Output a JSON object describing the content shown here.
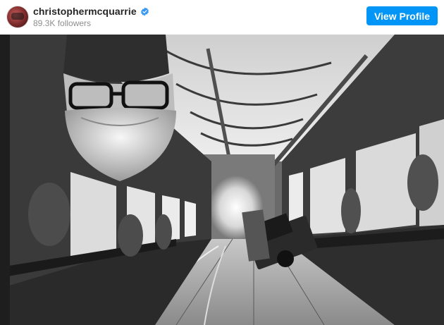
{
  "post_header": {
    "username": "christophermcquarrie",
    "followers": "89.3K followers",
    "view_profile_label": "View Profile",
    "verified_icon": "verified-badge-icon",
    "accent_color": "#0095f6"
  },
  "photo": {
    "kind": "black-and-white photograph",
    "colors": {
      "tone": "grayscale"
    }
  }
}
